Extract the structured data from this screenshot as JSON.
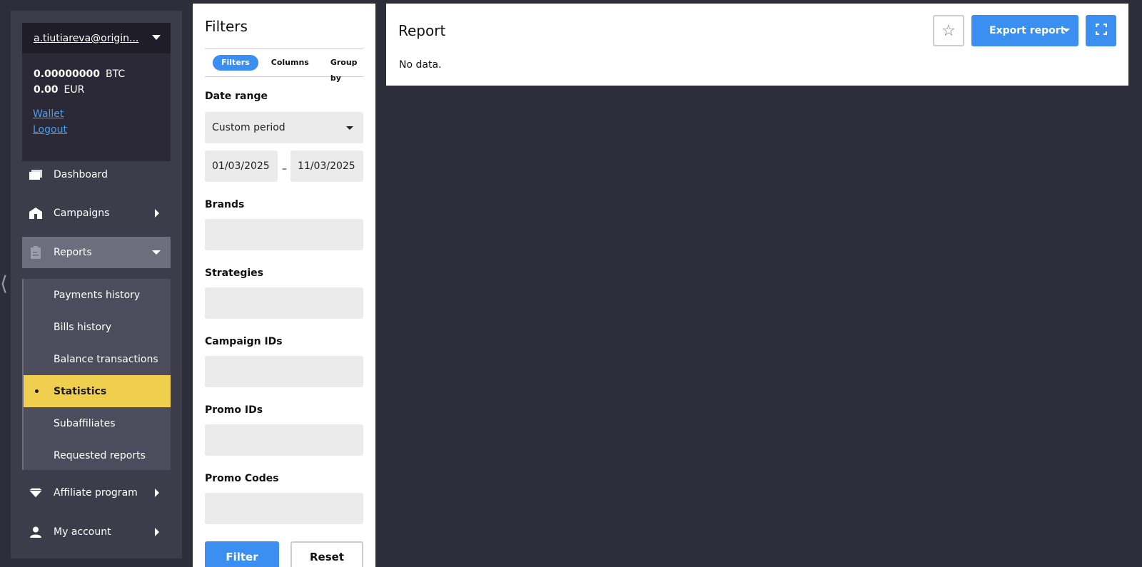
{
  "sidebar": {
    "account": {
      "email": "a.tiutiareva@origin...",
      "balances": [
        {
          "amount": "0.00000000",
          "currency": "BTC"
        },
        {
          "amount": "0.00",
          "currency": "EUR"
        }
      ],
      "links": {
        "wallet": "Wallet",
        "logout": "Logout"
      }
    },
    "nav": {
      "dashboard": "Dashboard",
      "campaigns": "Campaigns",
      "reports": "Reports",
      "affiliate_program": "Affiliate program",
      "my_account": "My account"
    },
    "reports_submenu": [
      {
        "label": "Payments history"
      },
      {
        "label": "Bills history"
      },
      {
        "label": "Balance transactions"
      },
      {
        "label": "Statistics",
        "active": true
      },
      {
        "label": "Subaffiliates"
      },
      {
        "label": "Requested reports"
      }
    ]
  },
  "filters": {
    "title": "Filters",
    "tabs": {
      "filters": "Filters",
      "columns": "Columns",
      "group_by": "Group by"
    },
    "date_range": {
      "label": "Date range",
      "selected": "Custom period",
      "from": "01/03/2025",
      "to": "11/03/2025",
      "separator": "–"
    },
    "brands_label": "Brands",
    "strategies_label": "Strategies",
    "campaign_ids_label": "Campaign IDs",
    "promo_ids_label": "Promo IDs",
    "promo_codes_label": "Promo Codes",
    "buttons": {
      "filter": "Filter",
      "reset": "Reset"
    }
  },
  "report": {
    "title": "Report",
    "empty_text": "No data.",
    "export_label": "Export report"
  },
  "colors": {
    "accent": "#3a8ff0",
    "active_item": "#f0cf4f",
    "background": "#2e2d3a"
  }
}
